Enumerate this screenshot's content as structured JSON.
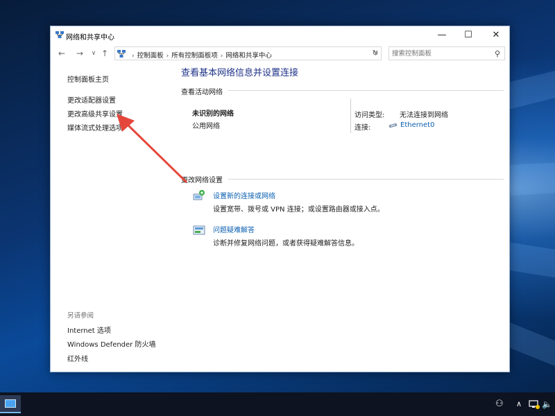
{
  "window": {
    "title": "网络和共享中心",
    "controls": {
      "minimize": "—",
      "maximize": "☐",
      "close": "✕"
    }
  },
  "address": {
    "crumbs": [
      "控制面板",
      "所有控制面板项",
      "网络和共享中心"
    ],
    "search_placeholder": "搜索控制面板"
  },
  "sidebar": {
    "home": "控制面板主页",
    "links": [
      "更改适配器设置",
      "更改高级共享设置",
      "媒体流式处理选项"
    ],
    "see_also_caption": "另请参阅",
    "see_also": [
      "Internet 选项",
      "Windows Defender 防火墙",
      "红外线"
    ]
  },
  "main": {
    "title": "查看基本网络信息并设置连接",
    "active_section": "查看活动网络",
    "network": {
      "name": "未识别的网络",
      "type": "公用网络",
      "access_label": "访问类型:",
      "access_value": "无法连接到网络",
      "conn_label": "连接:",
      "conn_value": "Ethernet0"
    },
    "change_section": "更改网络设置",
    "tasks": [
      {
        "link": "设置新的连接或网络",
        "desc": "设置宽带、拨号或 VPN 连接；或设置路由器或接入点。"
      },
      {
        "link": "问题疑难解答",
        "desc": "诊断并修复网络问题，或者获得疑难解答信息。"
      }
    ]
  },
  "colors": {
    "link": "#0b5fb0",
    "title": "#1e3287",
    "annotation_arrow": "#e5463c"
  }
}
